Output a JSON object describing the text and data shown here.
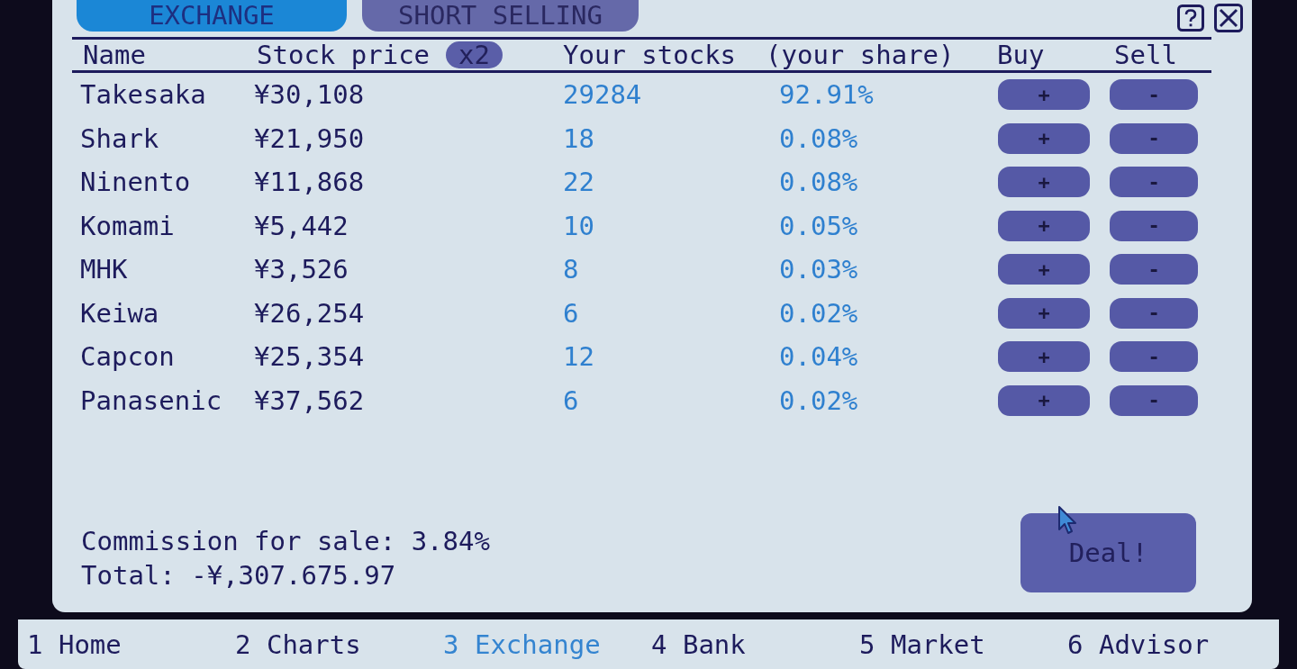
{
  "tabs": [
    {
      "label": "EXCHANGE",
      "selected": true
    },
    {
      "label": "SHORT SELLING",
      "selected": false
    }
  ],
  "table": {
    "columns": [
      {
        "label": "Name"
      },
      {
        "label": "Stock price",
        "badge": "x2"
      },
      {
        "label": "Your stocks"
      },
      {
        "label": "(your share)"
      },
      {
        "label": "Buy"
      },
      {
        "label": "Sell"
      }
    ],
    "rows": [
      {
        "name": "Takesaka",
        "price": "¥30,108",
        "stocks": "29284",
        "share": "92.91%",
        "buy": "+",
        "sell": "-"
      },
      {
        "name": "Shark",
        "price": "¥21,950",
        "stocks": "18",
        "share": "0.08%",
        "buy": "+",
        "sell": "-"
      },
      {
        "name": "Ninento",
        "price": "¥11,868",
        "stocks": "22",
        "share": "0.08%",
        "buy": "+",
        "sell": "-"
      },
      {
        "name": "Komami",
        "price": "¥5,442",
        "stocks": "10",
        "share": "0.05%",
        "buy": "+",
        "sell": "-"
      },
      {
        "name": "MHK",
        "price": "¥3,526",
        "stocks": "8",
        "share": "0.03%",
        "buy": "+",
        "sell": "-"
      },
      {
        "name": "Keiwa",
        "price": "¥26,254",
        "stocks": "6",
        "share": "0.02%",
        "buy": "+",
        "sell": "-"
      },
      {
        "name": "Capcon",
        "price": "¥25,354",
        "stocks": "12",
        "share": "0.04%",
        "buy": "+",
        "sell": "-"
      },
      {
        "name": "Panasenic",
        "price": "¥37,562",
        "stocks": "6",
        "share": "0.02%",
        "buy": "+",
        "sell": "-"
      }
    ]
  },
  "summary": {
    "commission": "Commission for sale: 3.84%",
    "total": "Total: -¥,307.675.97"
  },
  "deal_button": "Deal!",
  "nav": [
    {
      "label": "1 Home",
      "selected": false
    },
    {
      "label": "2 Charts",
      "selected": false
    },
    {
      "label": "3 Exchange",
      "selected": true
    },
    {
      "label": "4 Bank",
      "selected": false
    },
    {
      "label": "5 Market",
      "selected": false
    },
    {
      "label": "6 Advisor",
      "selected": false
    }
  ]
}
